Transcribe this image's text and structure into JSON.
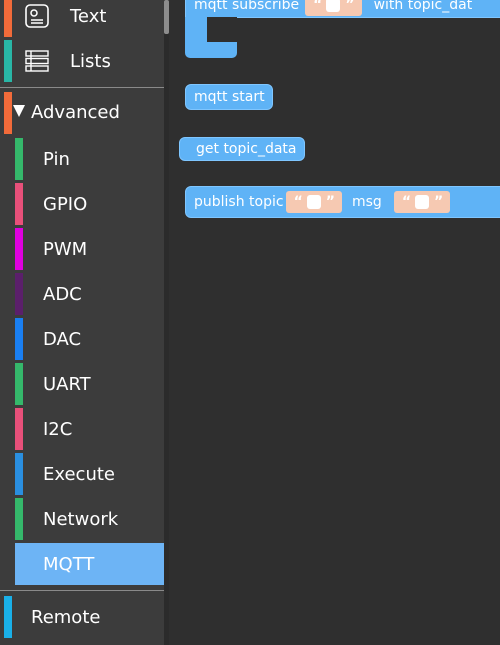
{
  "toolbox": {
    "categories_top": [
      {
        "label": "Text",
        "color": "#f26b3a",
        "icon": "text-block-icon"
      },
      {
        "label": "Lists",
        "color": "#29b6a6",
        "icon": "list-icon"
      }
    ],
    "advanced": {
      "label": "Advanced",
      "color": "#f26b3a",
      "expanded": true
    },
    "sub_categories": [
      {
        "label": "Pin",
        "color": "#35b86b"
      },
      {
        "label": "GPIO",
        "color": "#e8507a"
      },
      {
        "label": "PWM",
        "color": "#e000e0"
      },
      {
        "label": "ADC",
        "color": "#5b1f6b"
      },
      {
        "label": "DAC",
        "color": "#1a7ff2"
      },
      {
        "label": "UART",
        "color": "#35b86b"
      },
      {
        "label": "I2C",
        "color": "#e8507a"
      },
      {
        "label": "Execute",
        "color": "#2a8fe0"
      },
      {
        "label": "Network",
        "color": "#35b86b"
      },
      {
        "label": "MQTT",
        "color": "#6db4f5",
        "selected": true
      }
    ],
    "remote": {
      "label": "Remote",
      "color": "#1ab0e8"
    }
  },
  "workspace": {
    "subscribe_block": {
      "prefix": "mqtt subscribe",
      "suffix": "with topic_dat"
    },
    "start_block": {
      "label": "mqtt start"
    },
    "get_block": {
      "label": "get topic_data"
    },
    "publish_block": {
      "prefix": "publish topic",
      "middle": "msg"
    },
    "string_open_quote": "“",
    "string_close_quote": "”"
  }
}
